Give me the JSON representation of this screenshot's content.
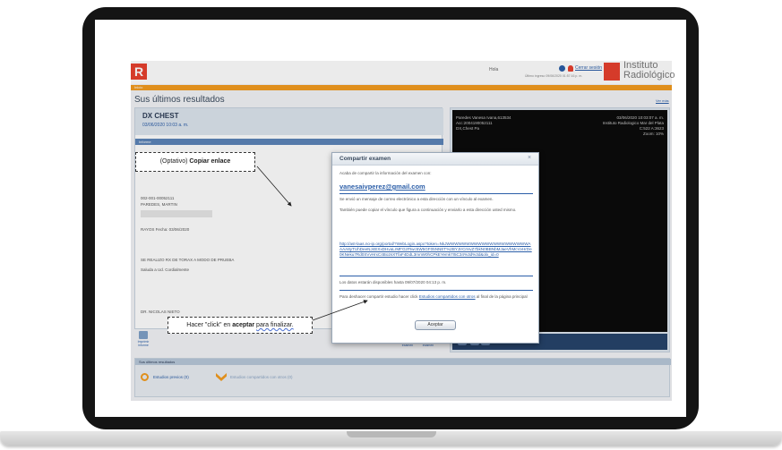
{
  "header": {
    "greeting": "Hola",
    "last_access": "Último ingreso 09/06/2020 01:57:16 p. m.",
    "logout_label": "Cerrar sesión",
    "brand_line1": "Instituto",
    "brand_line2": "Radiológico",
    "logo_letter": "R"
  },
  "nav": {
    "home_label": "Inicio"
  },
  "results": {
    "title": "Sus últimos resultados",
    "ver_mas": "Ver más"
  },
  "study": {
    "title": "DX CHEST",
    "date": "03/06/2020 10:03 a. m.",
    "informe_label": "Informe",
    "lines": [
      "002-001-00052111",
      "PAREDES, MARTIN",
      "RAYOS Fecha: 03/06/2020",
      "SE REALIZO RX DE TORAX A MODO DE PRUEBA",
      "Saluda a Ud. Cordialmente",
      "DR. NICOLAS NIETO"
    ]
  },
  "tools": {
    "print_label": "Imprimir informe",
    "save_label": "Guardar examen",
    "share_label": "Compartir examen"
  },
  "viewer": {
    "patient_line1": "Paredes Vanesa Ivana,613534",
    "patient_line2": "Acc:2004190052111",
    "patient_line3": "DX,Chest Pa",
    "date_time": "03/06/2020 10:03:07 a. m.",
    "institute": "Instituto Radiologico Mar del Plata",
    "window": "C:522 A:3623",
    "zoom": "Zoom: 10%",
    "nav_prev": "‹‹",
    "nav_next": "››"
  },
  "bottom": {
    "section_label": "Sus últimos resultados",
    "previous_label": "Estudios previos (0)",
    "shared_label": "Estudios compartidos con otros (0)"
  },
  "modal": {
    "title": "Compartir examen",
    "close": "×",
    "intro": "Acaba de compartir la información del examen con:",
    "email": "vanesaivperez@gmail.com",
    "sent_msg": "Se envió un mensaje de correo electrónico a esta dirección con un vínculo al examen.",
    "copy_msg": "También puede copiar el vínculo que figura a continuación y enviarlo a esta dirección usted mismo.",
    "link": "http://ast-laas.no-ip.org/portal/?WebLogin.aspx?token=NkJWWWWWWWWWWWWWWWWWWWWWAAAA8yTUhDeeNJ4EXxDHvaLrMFGzPIwc5W5GF05NNET%2BYJIrCrHvZ7bkN0BBNbMJaeVhMcVvHrDe0KNeku7Rd0SVvHrxC4Bo2sXTfaF4DdL3mnW0hCPkEYemk7I5C34%3d%3d&olx_id=0",
    "expiry": "Los datos estarán disponibles hasta 09/07/2020 04:13 p. m.",
    "unshare_pre": "Para deshacer compartir estudio hacer click",
    "unshare_link": "Estudios compartidos con otros",
    "unshare_post": "al final de la página principal",
    "accept": "Aceptar"
  },
  "callouts": {
    "copy_prefix": "(Optativo)",
    "copy_bold": "Copiar enlace",
    "accept_pre": "Hacer \"click\" en",
    "accept_bold": "aceptar",
    "accept_post": "para finalizar."
  }
}
